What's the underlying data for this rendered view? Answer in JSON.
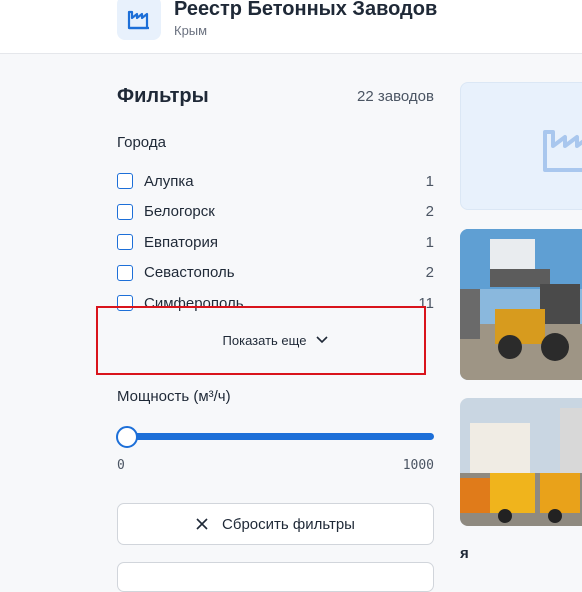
{
  "header": {
    "title": "Реестр Бетонных Заводов",
    "subtitle": "Крым",
    "logo_icon": "factory-icon"
  },
  "filters": {
    "title": "Фильтры",
    "count": "22 заводов",
    "cities_label": "Города",
    "cities": [
      {
        "name": "Алупка",
        "count": "1"
      },
      {
        "name": "Белогорск",
        "count": "2"
      },
      {
        "name": "Евпатория",
        "count": "1"
      },
      {
        "name": "Севастополь",
        "count": "2"
      },
      {
        "name": "Симферополь",
        "count": "11"
      }
    ],
    "show_more": "Показать еще",
    "power_label": "Мощность (м³/ч)",
    "power_min": "0",
    "power_max": "1000",
    "reset": "Сбросить фильтры"
  },
  "cards": {
    "snippet": "я"
  },
  "colors": {
    "accent": "#1d6fd8",
    "highlight": "#d9141c",
    "logo_bg": "#e8f1fc"
  }
}
